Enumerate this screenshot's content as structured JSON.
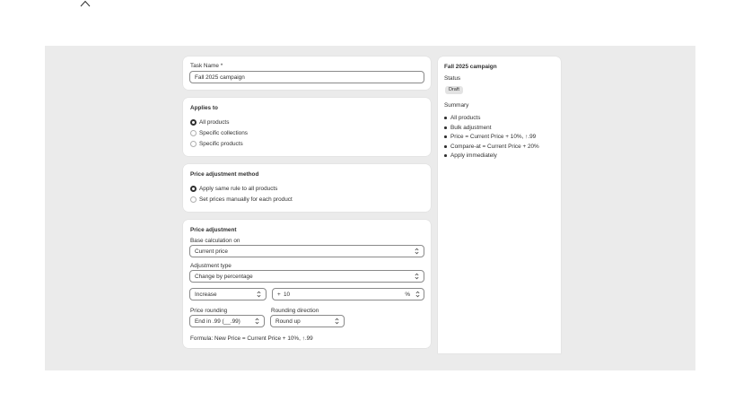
{
  "task_name": {
    "label": "Task Name *",
    "value": "Fall 2025 campaign"
  },
  "applies_to": {
    "title": "Applies to",
    "options": [
      "All products",
      "Specific collections",
      "Specific products"
    ],
    "selected": "All products"
  },
  "method": {
    "title": "Price adjustment method",
    "options": [
      "Apply same rule to all products",
      "Set prices manually for each product"
    ],
    "selected": "Apply same rule to all products"
  },
  "price_adjustment": {
    "title": "Price adjustment",
    "base_label": "Base calculation on",
    "base_value": "Current price",
    "type_label": "Adjustment type",
    "type_value": "Change by percentage",
    "direction_value": "Increase",
    "amount_prefix": "+",
    "amount_value": "10",
    "amount_suffix": "%",
    "rounding_label": "Price rounding",
    "rounding_value": "End in .99 (__.99)",
    "rounding_dir_label": "Rounding direction",
    "rounding_dir_value": "Round up",
    "formula": "Formula: New Price = Current Price + 10%, ↑.99"
  },
  "summary_panel": {
    "title": "Fall 2025 campaign",
    "status_label": "Status",
    "status_badge": "Draft",
    "summary_label": "Summary",
    "items": [
      "All products",
      "Bulk adjustment",
      "Price = Current Price + 10%, ↑.99",
      "Compare-at = Current Price + 20%",
      "Apply immediately"
    ]
  },
  "icons": {
    "collapse": "chevron-up-icon",
    "select": "select-arrows-icon"
  },
  "colors": {
    "backdrop": "#ebebeb",
    "card": "#ffffff",
    "text": "#303030",
    "border": "#8a8a8a"
  }
}
